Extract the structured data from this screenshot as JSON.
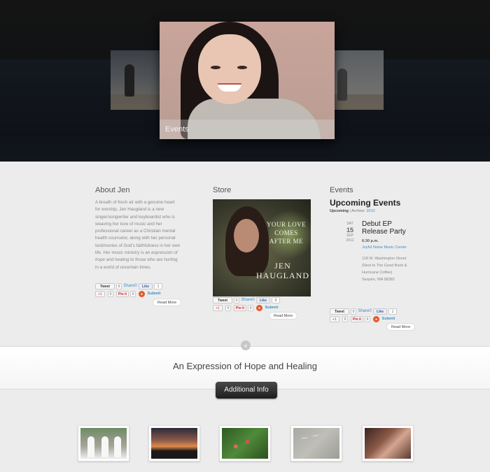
{
  "hero": {
    "caption": "Events"
  },
  "columns": {
    "about": {
      "title": "About Jen",
      "text_plain_1": "A breath of fresh air with a genuine heart for worship, Jen Haugland is a new singer/songwriter and keyboardist who is weaving her love of music and her professional career as a Christian mental health counselor, along with her personal testimonies of God’s faithfulness in her own life. Her music ministry is an ",
      "text_em": "expression of hope and healing",
      "text_plain_2": " to those who are hurting in a world of uncertain times.",
      "read_more": "Read More"
    },
    "store": {
      "title": "Store",
      "album_title": "YOUR LOVE COMES AFTER ME",
      "album_artist": "JEN HAUGLAND",
      "read_more": "Read More"
    },
    "events": {
      "title": "Events",
      "heading": "Upcoming Events",
      "sub_active": "Upcoming",
      "sub_sep": " | Archive: ",
      "sub_archive": "2012",
      "event": {
        "dow": "SAT",
        "day": "15",
        "month": "SEP",
        "year": "2012",
        "title": "Debut EP Release Party",
        "time": "6:30 p.m.",
        "venue": "Joyful Noise Music Center",
        "address_1": "118 W. Washington Street",
        "address_2": "(Next to The Good Book & Hurricane Coffee)",
        "address_3": "Sequim, WA 98382"
      },
      "read_more": "Read More"
    }
  },
  "share": {
    "tweet": "Tweet",
    "tweet_count": "0",
    "share_label": "Share",
    "share_count": "0",
    "like": "Like",
    "like_count_about": "1",
    "like_count_store": "0",
    "like_count_events": "1",
    "gplus": "+1",
    "gplus_count": "0",
    "pinit": "Pin it",
    "pin_count": "0",
    "submit": "Submit",
    "stumble_icon": "stumbleupon-icon"
  },
  "banner": {
    "tagline": "An Expression of Hope and Healing",
    "additional_info": "Additional Info",
    "collapse_glyph": "«"
  },
  "colors": {
    "link_blue": "#3d8fc7",
    "hero_bg": "#141414",
    "button_dark": "#1e1e1e"
  }
}
